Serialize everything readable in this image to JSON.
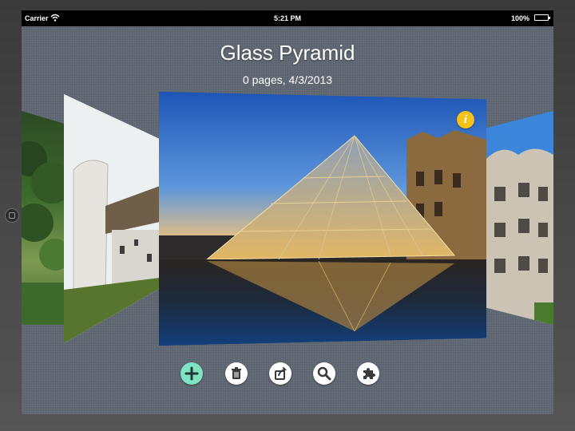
{
  "status_bar": {
    "carrier": "Carrier",
    "time": "5:21 PM",
    "battery": "100%"
  },
  "album": {
    "title": "Glass Pyramid",
    "subtitle": "0 pages, 4/3/2013"
  },
  "carousel": {
    "cards": [
      "forest-photo",
      "chapel-photo",
      "louvre-pyramid-photo",
      "casa-mila-photo"
    ],
    "selected": "louvre-pyramid-photo"
  },
  "toolbar": {
    "buttons": [
      "add-icon",
      "trash-icon",
      "share-icon",
      "search-icon",
      "puzzle-icon"
    ],
    "add_color": "#7fe3c4"
  },
  "colors": {
    "background": "#5f6873",
    "info_badge": "#f4c21a"
  }
}
